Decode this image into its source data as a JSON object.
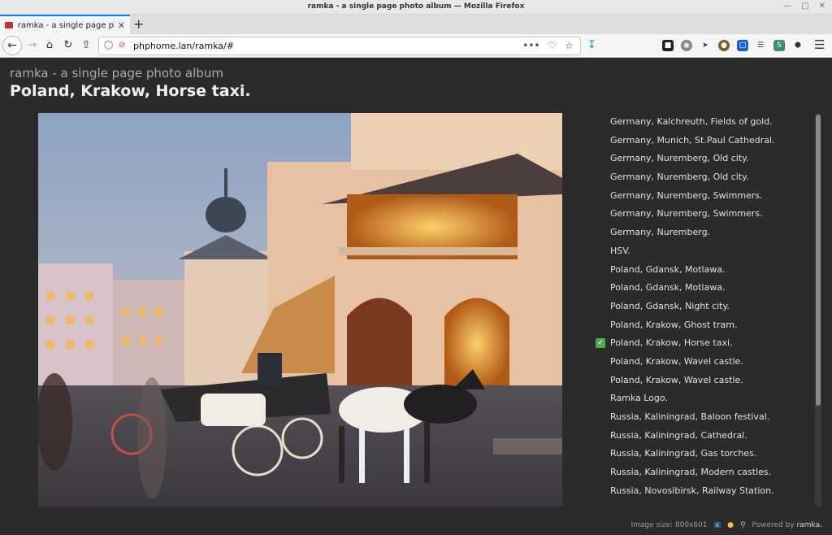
{
  "window": {
    "title": "ramka - a single page photo album — Mozilla Firefox"
  },
  "tab": {
    "label": "ramka - a single page photo"
  },
  "navbar": {
    "url": "phphome.lan/ramka/#",
    "page_actions": "•••"
  },
  "app": {
    "title": "ramka - a single page photo album",
    "photo_title": "Poland, Krakow, Horse taxi."
  },
  "photos": [
    {
      "label": "Germany, Kalchreuth, Fields of gold.",
      "selected": false
    },
    {
      "label": "Germany, Munich, St.Paul Cathedral.",
      "selected": false
    },
    {
      "label": "Germany, Nuremberg, Old city.",
      "selected": false
    },
    {
      "label": "Germany, Nuremberg, Old city.",
      "selected": false
    },
    {
      "label": "Germany, Nuremberg, Swimmers.",
      "selected": false
    },
    {
      "label": "Germany, Nuremberg, Swimmers.",
      "selected": false
    },
    {
      "label": "Germany, Nuremberg.",
      "selected": false
    },
    {
      "label": "HSV.",
      "selected": false
    },
    {
      "label": "Poland, Gdansk, Motlawa.",
      "selected": false
    },
    {
      "label": "Poland, Gdansk, Motlawa.",
      "selected": false
    },
    {
      "label": "Poland, Gdansk, Night city.",
      "selected": false
    },
    {
      "label": "Poland, Krakow, Ghost tram.",
      "selected": false
    },
    {
      "label": "Poland, Krakow, Horse taxi.",
      "selected": true
    },
    {
      "label": "Poland, Krakow, Wavel castle.",
      "selected": false
    },
    {
      "label": "Poland, Krakow, Wavel castle.",
      "selected": false
    },
    {
      "label": "Ramka Logo.",
      "selected": false
    },
    {
      "label": "Russia, Kaliningrad, Baloon festival.",
      "selected": false
    },
    {
      "label": "Russia, Kaliningrad, Cathedral.",
      "selected": false
    },
    {
      "label": "Russia, Kaliningrad, Gas torches.",
      "selected": false
    },
    {
      "label": "Russia, Kaliningrad, Modern castles.",
      "selected": false
    },
    {
      "label": "Russia, Novosibirsk, Railway Station.",
      "selected": false
    }
  ],
  "footer": {
    "image_size": "Image size: 800x601",
    "powered_by": "Powered by",
    "brand": "ramka."
  },
  "colors": {
    "page_bg": "#2b2b2b",
    "accent": "#0a84ff",
    "check": "#4caf50"
  }
}
